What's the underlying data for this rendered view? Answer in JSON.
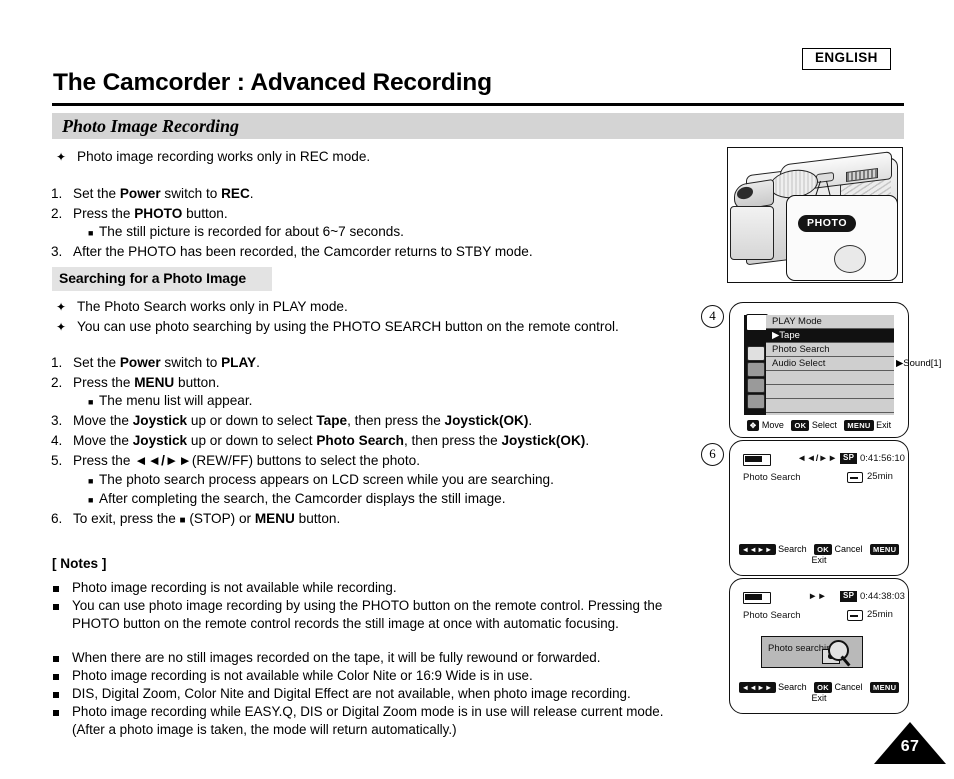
{
  "header": {
    "language_badge": "ENGLISH",
    "title": "The Camcorder : Advanced Recording"
  },
  "section": {
    "band_title": "Photo Image Recording",
    "bullet_diamond": "Photo image recording works only in REC mode.",
    "steps": [
      {
        "num": "1.",
        "text": "Set the Power switch to REC."
      },
      {
        "num": "2.",
        "text": "Press the PHOTO button."
      },
      {
        "sub": "The still picture is recorded for about 6~7 seconds."
      },
      {
        "num": "3.",
        "text": "After the PHOTO has been recorded, the Camcorder returns to STBY mode."
      }
    ]
  },
  "subsection": {
    "band_title": "Searching for a Photo Image",
    "diamonds": [
      "The Photo Search works only in PLAY mode.",
      "You can use photo searching by using the PHOTO SEARCH button on the remote control."
    ],
    "steps": [
      {
        "num": "1.",
        "text": "Set the Power switch to PLAY."
      },
      {
        "num": "2.",
        "text": "Press the MENU button."
      },
      {
        "sub": "The menu list will appear."
      },
      {
        "num": "3.",
        "text": "Move the Joystick up or down to select Tape, then press the Joystick(OK)."
      },
      {
        "num": "4.",
        "text": "Move the Joystick up or down to select Photo Search, then press the Joystick(OK)."
      },
      {
        "num": "5.",
        "text": "Press the ◄◄/►►(REW/FF) buttons to select the photo."
      },
      {
        "sub": "The photo search process appears on LCD screen while you are searching."
      },
      {
        "sub": "After completing the search, the Camcorder displays the still image."
      },
      {
        "num": "6.",
        "text": "To exit, press the ■ (STOP) or MENU button."
      }
    ]
  },
  "notes": {
    "title": "[ Notes ]",
    "items": [
      "Photo image recording is not available while recording.",
      "You can use photo image recording by using the PHOTO button on the remote control. Pressing the PHOTO button on the remote control records the still image at once with automatic focusing.",
      "When there are no still images recorded on the tape, it will be fully rewound or forwarded.",
      "Photo image recording is not available while Color Nite or 16:9 Wide is in use.",
      "DIS, Digital Zoom, Color Nite and Digital Effect are not available, when photo image recording.",
      "Photo image recording while EASY.Q, DIS or Digital Zoom mode is in use will release current mode. (After a photo image is taken, the mode will return automatically.)"
    ]
  },
  "illustrations": {
    "camcorder": {
      "callout_label": "PHOTO"
    },
    "menu_screen": {
      "step_number": "4",
      "title": "PLAY Mode",
      "rows": [
        {
          "label": "▶Tape",
          "selected": true
        },
        {
          "label": "Photo Search",
          "selected": false
        },
        {
          "label": "Audio Select",
          "selected": false
        }
      ],
      "submenu_value": "▶Sound[1]",
      "footer": [
        {
          "key": "✥",
          "label": "Move"
        },
        {
          "key": "OK",
          "label": "Select"
        },
        {
          "key": "MENU",
          "label": "Exit"
        }
      ]
    },
    "osd_search": {
      "step_number": "6",
      "transport": "◄◄/►►",
      "mode_chip": "SP",
      "timecode": "0:41:56:10",
      "status_label": "Photo Search",
      "tape_remaining": "25min",
      "footer": [
        {
          "key": "◄◄►►",
          "label": "Search"
        },
        {
          "key": "OK",
          "label": "Cancel"
        },
        {
          "key": "MENU",
          "label": "Exit"
        }
      ]
    },
    "osd_searching": {
      "transport": "►►",
      "mode_chip": "SP",
      "timecode": "0:44:38:03",
      "status_label": "Photo Search",
      "tape_remaining": "25min",
      "dialog_text": "Photo searching...",
      "footer": [
        {
          "key": "◄◄►►",
          "label": "Search"
        },
        {
          "key": "OK",
          "label": "Cancel"
        },
        {
          "key": "MENU",
          "label": "Exit"
        }
      ]
    }
  },
  "page_number": "67"
}
